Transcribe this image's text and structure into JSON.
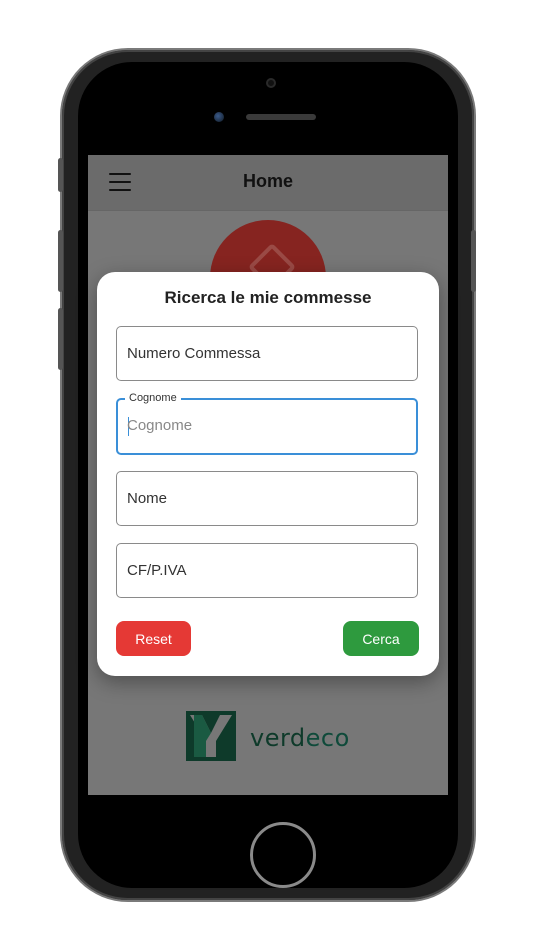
{
  "appbar": {
    "title": "Home"
  },
  "dialog": {
    "title": "Ricerca le mie commesse",
    "fields": {
      "numero_commessa": {
        "placeholder": "Numero Commessa"
      },
      "cognome": {
        "label": "Cognome",
        "placeholder": "Cognome"
      },
      "nome": {
        "placeholder": "Nome"
      },
      "cf_piva": {
        "placeholder": "CF/P.IVA"
      }
    },
    "reset_label": "Reset",
    "search_label": "Cerca"
  },
  "logo": {
    "text_dark": "verd",
    "text_accent": "eco"
  },
  "colors": {
    "reset": "#e53935",
    "search": "#2e9a3e",
    "focus": "#3a8fd8",
    "brand": "#0e3a2a",
    "accent_circle": "#862420"
  }
}
